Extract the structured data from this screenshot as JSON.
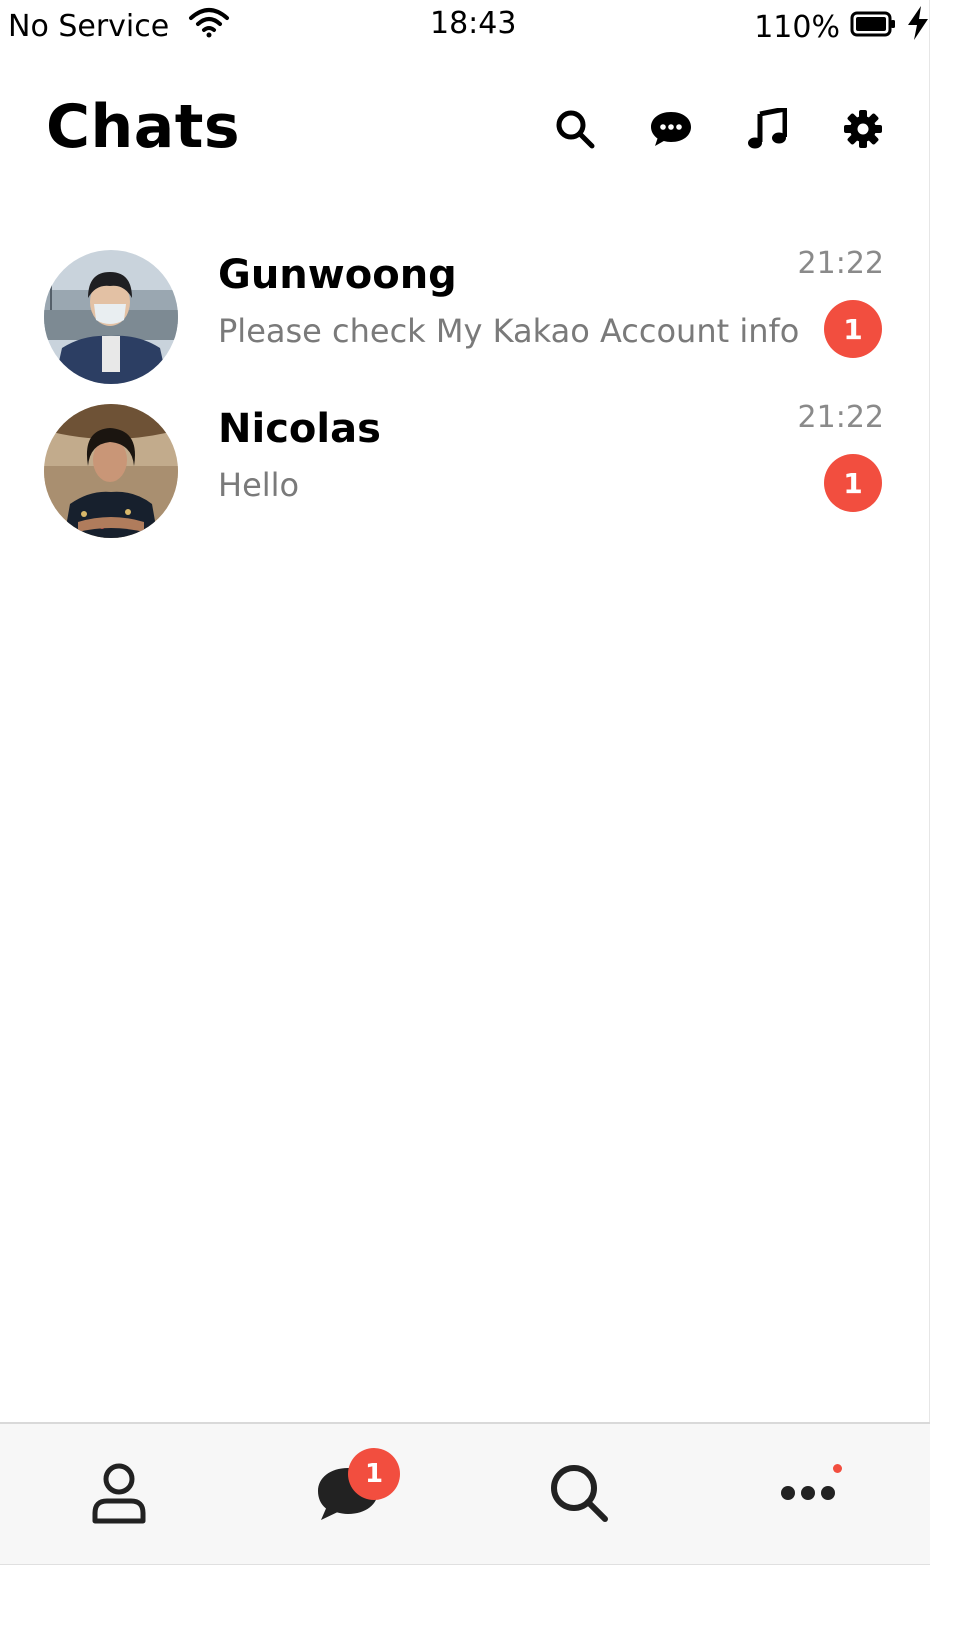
{
  "status_bar": {
    "carrier": "No Service",
    "time": "18:43",
    "battery": "110%",
    "icons": [
      "wifi-icon",
      "battery-icon",
      "charging-bolt-icon"
    ]
  },
  "header": {
    "title": "Chats",
    "icons": [
      "search-icon",
      "chat-bubble-icon",
      "music-note-icon",
      "gear-icon"
    ]
  },
  "chats": [
    {
      "name": "Gunwoong",
      "preview": "Please check My Kakao Account info",
      "time": "21:22",
      "unread": "1"
    },
    {
      "name": "Nicolas",
      "preview": "Hello",
      "time": "21:22",
      "unread": "1"
    }
  ],
  "tabbar": {
    "tabs": [
      {
        "icon": "person-icon"
      },
      {
        "icon": "chat-bubble-icon",
        "badge": "1"
      },
      {
        "icon": "search-icon"
      },
      {
        "icon": "more-dots-icon",
        "has_dot": true
      }
    ]
  },
  "colors": {
    "badge": "#f24e3f",
    "tabbar_bg": "#f7f7f7"
  }
}
